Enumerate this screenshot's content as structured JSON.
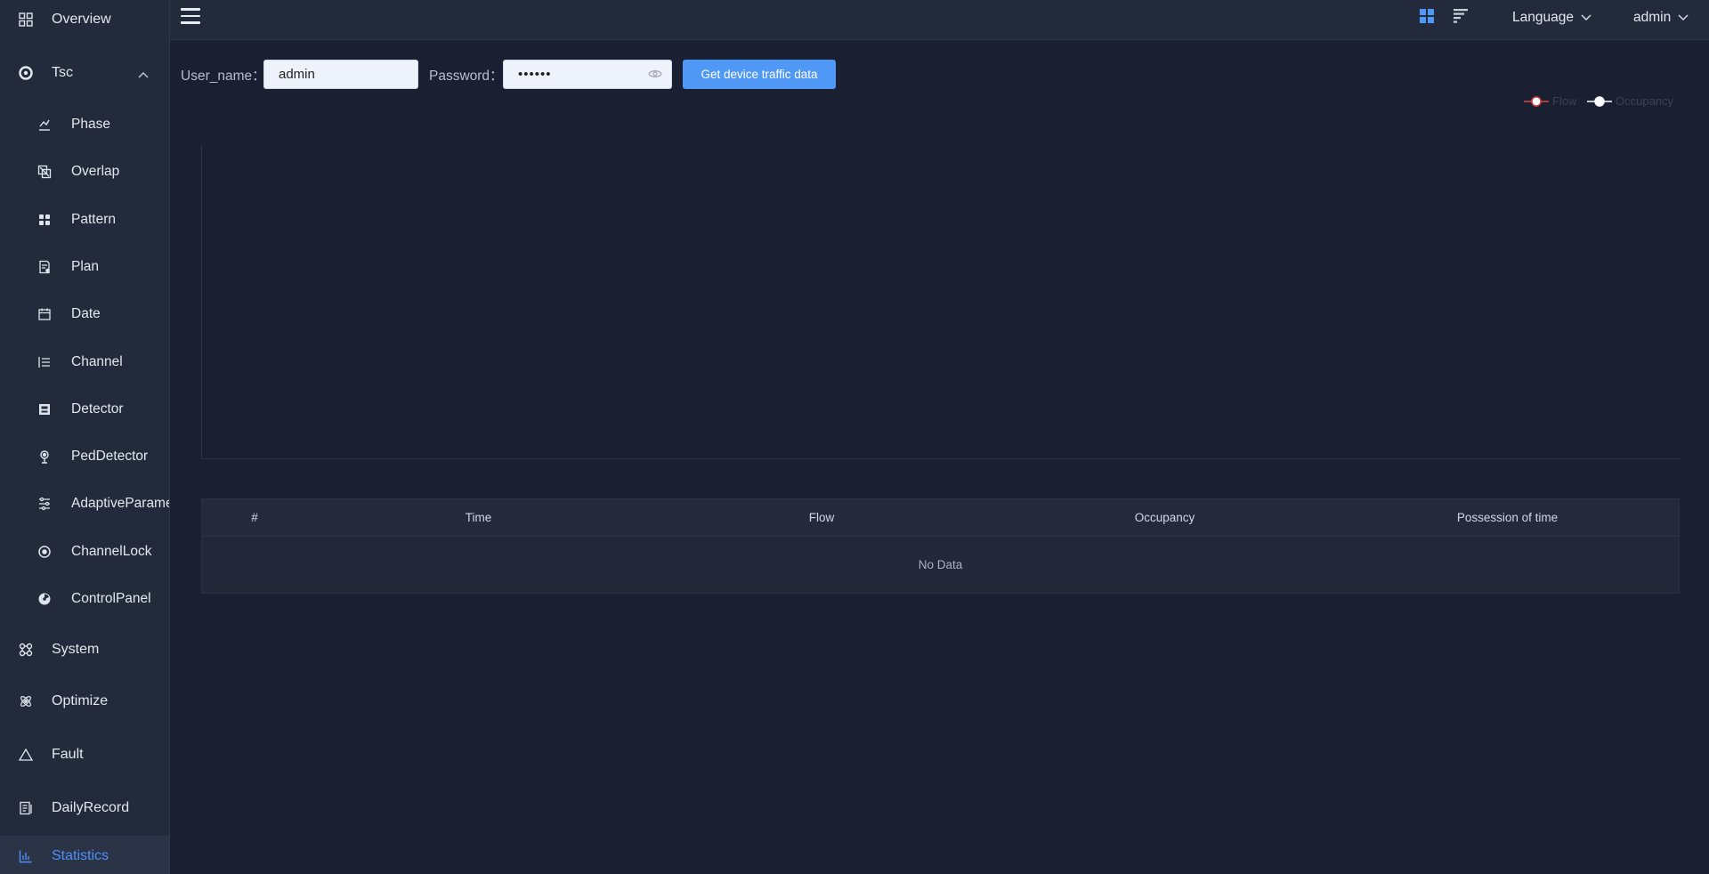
{
  "sidebar": {
    "items": [
      {
        "label": "Overview",
        "icon": "grid-icon"
      },
      {
        "label": "Tsc",
        "icon": "aperture-icon",
        "expanded": true
      },
      {
        "label": "Phase",
        "icon": "phase-icon"
      },
      {
        "label": "Overlap",
        "icon": "overlap-icon"
      },
      {
        "label": "Pattern",
        "icon": "pattern-icon"
      },
      {
        "label": "Plan",
        "icon": "plan-icon"
      },
      {
        "label": "Date",
        "icon": "calendar-icon"
      },
      {
        "label": "Channel",
        "icon": "channel-icon"
      },
      {
        "label": "Detector",
        "icon": "detector-icon"
      },
      {
        "label": "PedDetector",
        "icon": "pedestrian-icon"
      },
      {
        "label": "AdaptiveParameter",
        "icon": "sliders-icon"
      },
      {
        "label": "ChannelLock",
        "icon": "lock-icon"
      },
      {
        "label": "ControlPanel",
        "icon": "control-panel-icon"
      },
      {
        "label": "System",
        "icon": "command-icon"
      },
      {
        "label": "Optimize",
        "icon": "atom-icon"
      },
      {
        "label": "Fault",
        "icon": "warning-icon"
      },
      {
        "label": "DailyRecord",
        "icon": "record-icon"
      },
      {
        "label": "Statistics",
        "icon": "bar-chart-icon",
        "active": true
      }
    ]
  },
  "header": {
    "language_label": "Language",
    "user_label": "admin",
    "accent_color": "#4f98f5"
  },
  "form": {
    "username_label": "User_name：",
    "username_value": "admin",
    "password_label": "Password：",
    "password_value": "••••••",
    "submit_label": "Get device traffic data"
  },
  "chart_data": {
    "type": "line",
    "series": [
      {
        "name": "Flow",
        "color": "#d9463e",
        "values": []
      },
      {
        "name": "Occupancy",
        "color": "#ffffff",
        "values": []
      }
    ],
    "legend_position": "top-right"
  },
  "table": {
    "columns": [
      "#",
      "Time",
      "Flow",
      "Occupancy",
      "Possession of time"
    ],
    "empty_text": "No Data"
  }
}
